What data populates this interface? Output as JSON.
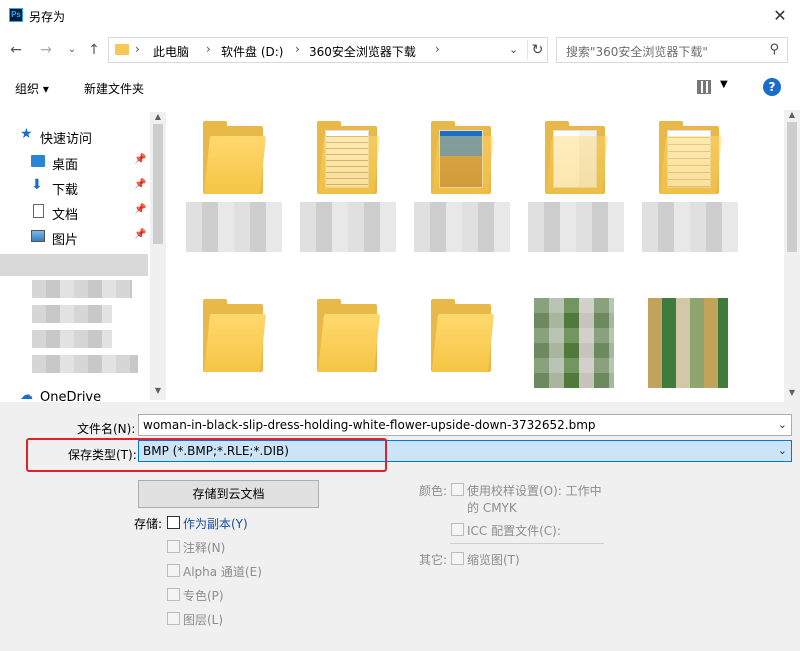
{
  "window": {
    "title": "另存为",
    "app_icon": "Ps"
  },
  "address": {
    "breadcrumbs": [
      "此电脑",
      "软件盘 (D:)",
      "360安全浏览器下载"
    ],
    "search_placeholder": "搜索\"360安全浏览器下载\""
  },
  "toolbar": {
    "organize": "组织 ▾",
    "new_folder": "新建文件夹"
  },
  "nav": {
    "quick_access": "快速访问",
    "items": [
      "桌面",
      "下载",
      "文档",
      "图片"
    ],
    "onedrive": "OneDrive"
  },
  "form": {
    "filename_label": "文件名(N):",
    "filename_value": "woman-in-black-slip-dress-holding-white-flower-upside-down-3732652.bmp",
    "type_label": "保存类型(T):",
    "type_value": "BMP (*.BMP;*.RLE;*.DIB)",
    "cloud_button": "存储到云文档",
    "storage_label": "存储:",
    "as_copy": "作为副本(Y)",
    "notes": "注释(N)",
    "alpha": "Alpha 通道(E)",
    "spot": "专色(P)",
    "layers": "图层(L)",
    "color_label": "颜色:",
    "proof_line1": "使用校样设置(O): 工作中",
    "proof_line2": "的 CMYK",
    "icc": "ICC 配置文件(C):",
    "other_label": "其它:",
    "thumbnail": "缩览图(T)"
  }
}
